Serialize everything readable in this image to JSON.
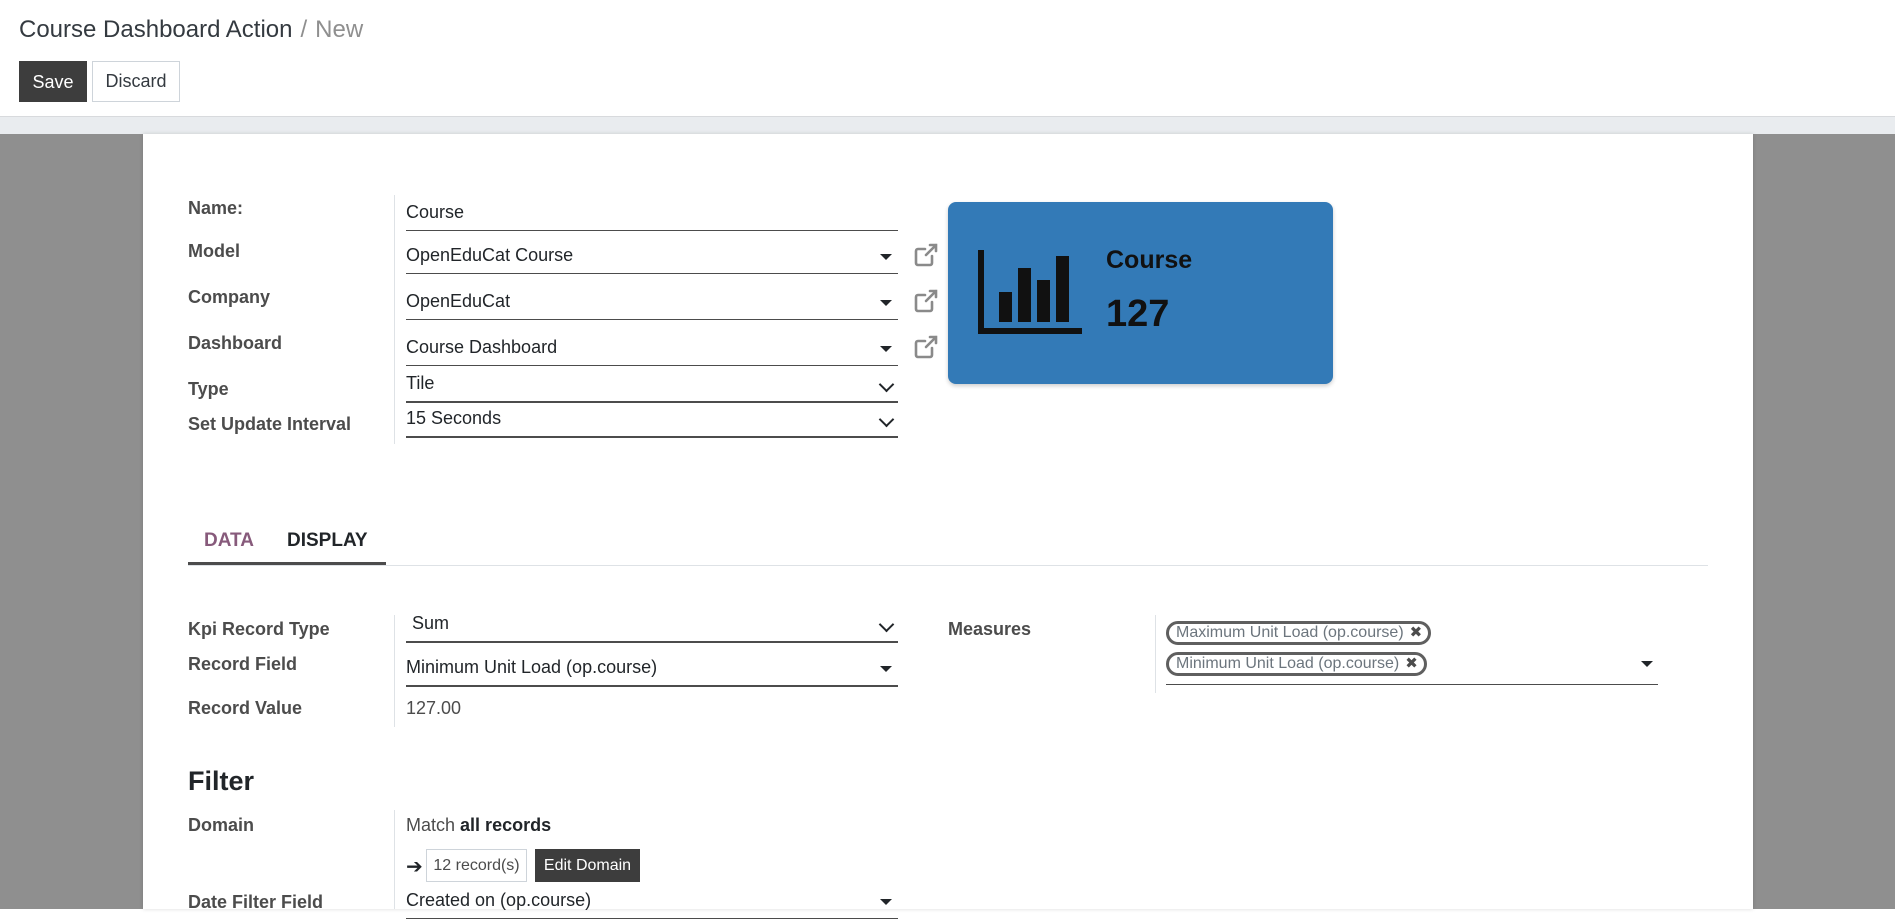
{
  "breadcrumb": {
    "parent": "Course Dashboard Action",
    "separator": "/",
    "current": "New"
  },
  "buttons": {
    "save": "Save",
    "discard": "Discard"
  },
  "form": {
    "name": {
      "label": "Name:",
      "value": "Course"
    },
    "model": {
      "label": "Model",
      "value": "OpenEduCat Course"
    },
    "company": {
      "label": "Company",
      "value": "OpenEduCat"
    },
    "dashboard": {
      "label": "Dashboard",
      "value": "Course Dashboard"
    },
    "type": {
      "label": "Type",
      "value": "Tile"
    },
    "update_interval": {
      "label": "Set Update Interval",
      "value": "15 Seconds"
    }
  },
  "tile_preview": {
    "title": "Course",
    "value": "127",
    "color": "#337ab7",
    "icon": "bar-chart-icon"
  },
  "tabs": [
    {
      "label": "DATA",
      "active": false
    },
    {
      "label": "DISPLAY",
      "active": true
    }
  ],
  "data_tab": {
    "kpi_record_type": {
      "label": "Kpi Record Type",
      "value": "Sum"
    },
    "record_field": {
      "label": "Record Field",
      "value": "Minimum Unit Load (op.course)"
    },
    "record_value": {
      "label": "Record Value",
      "value": "127.00"
    },
    "measures": {
      "label": "Measures",
      "tags": [
        "Maximum Unit Load (op.course)",
        "Minimum Unit Load (op.course)"
      ]
    }
  },
  "filter": {
    "title": "Filter",
    "domain": {
      "label": "Domain",
      "match_prefix": "Match",
      "match_bold": "all records",
      "record_count": "12 record(s)",
      "edit_button": "Edit Domain"
    },
    "date_filter_field": {
      "label": "Date Filter Field",
      "value": "Created on (op.course)"
    }
  },
  "colors": {
    "tab_active": "#875a7b",
    "primary_button": "#3d3d3d",
    "tile": "#337ab7"
  }
}
